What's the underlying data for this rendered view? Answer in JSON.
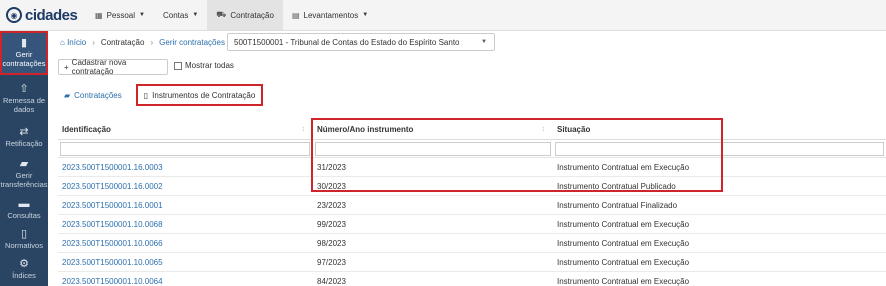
{
  "brand": {
    "name": "cidades"
  },
  "nav": [
    {
      "label": "Pessoal",
      "icon": "grid-icon",
      "caret": true
    },
    {
      "label": "Contas",
      "icon": "",
      "caret": true
    },
    {
      "label": "Contratação",
      "icon": "cart-icon",
      "caret": false,
      "active": true
    },
    {
      "label": "Levantamentos",
      "icon": "chart-icon",
      "caret": true
    }
  ],
  "sidebar": [
    {
      "label": "Gerir contratações",
      "icon": "document-icon",
      "active": true
    },
    {
      "label": "Remessa de dados",
      "icon": "upload-icon"
    },
    {
      "label": "Retificação",
      "icon": "exchange-icon"
    },
    {
      "label": "Gerir transferências",
      "icon": "folder-icon"
    },
    {
      "label": "Consultas",
      "icon": "book-icon"
    },
    {
      "label": "Normativos",
      "icon": "file-icon"
    },
    {
      "label": "Índices",
      "icon": "cogs-icon"
    }
  ],
  "breadcrumb": {
    "home": "Início",
    "level1": "Contratação",
    "level2": "Gerir contratações"
  },
  "unit_select": {
    "value": "500T1500001 - Tribunal de Contas do Estado do Espírito Santo"
  },
  "actions": {
    "add_label": "Cadastrar nova contratação",
    "show_all_label": "Mostrar todas"
  },
  "tabs": {
    "contratacoes": "Contratações",
    "instrumentos": "Instrumentos de Contratação"
  },
  "table": {
    "headers": {
      "identificacao": "Identificação",
      "numero": "Número/Ano instrumento",
      "situacao": "Situação"
    },
    "rows": [
      {
        "id": "2023.500T1500001.16.0003",
        "numero": "31/2023",
        "situacao": "Instrumento Contratual em Execução"
      },
      {
        "id": "2023.500T1500001.16.0002",
        "numero": "30/2023",
        "situacao": "Instrumento Contratual Publicado"
      },
      {
        "id": "2023.500T1500001.16.0001",
        "numero": "23/2023",
        "situacao": "Instrumento Contratual Finalizado"
      },
      {
        "id": "2023.500T1500001.10.0068",
        "numero": "99/2023",
        "situacao": "Instrumento Contratual em Execução"
      },
      {
        "id": "2023.500T1500001.10.0066",
        "numero": "98/2023",
        "situacao": "Instrumento Contratual em Execução"
      },
      {
        "id": "2023.500T1500001.10.0065",
        "numero": "97/2023",
        "situacao": "Instrumento Contratual em Execução"
      },
      {
        "id": "2023.500T1500001.10.0064",
        "numero": "84/2023",
        "situacao": "Instrumento Contratual em Execução"
      }
    ]
  },
  "colors": {
    "sidebar": "#2a4563",
    "link": "#2c6fad",
    "highlight": "#d0242b"
  }
}
